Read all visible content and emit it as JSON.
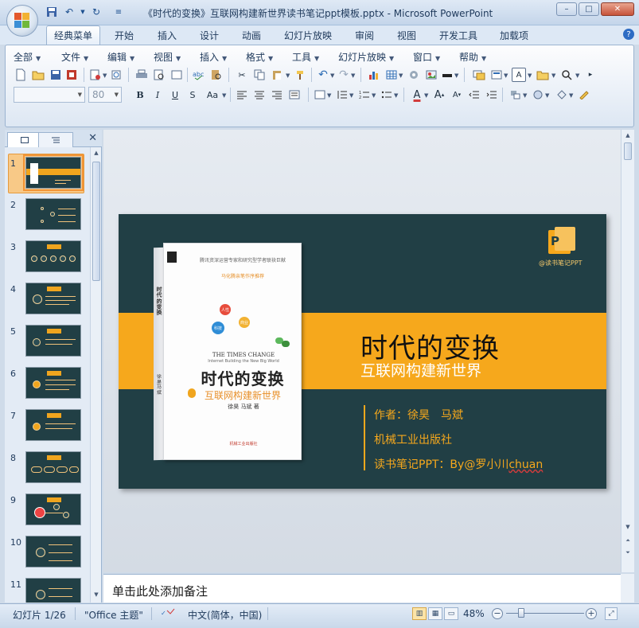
{
  "window": {
    "title": "《时代的变换》互联网构建新世界读书笔记ppt模板.pptx - Microsoft PowerPoint",
    "controls": {
      "minimize": "–",
      "maximize": "□",
      "close": "✕"
    }
  },
  "tabs": [
    {
      "label": "经典菜单",
      "active": true
    },
    {
      "label": "开始"
    },
    {
      "label": "插入"
    },
    {
      "label": "设计"
    },
    {
      "label": "动画"
    },
    {
      "label": "幻灯片放映"
    },
    {
      "label": "审阅"
    },
    {
      "label": "视图"
    },
    {
      "label": "开发工具"
    },
    {
      "label": "加载项"
    }
  ],
  "menus": [
    "全部",
    "文件",
    "编辑",
    "视图",
    "插入",
    "格式",
    "工具",
    "幻灯片放映",
    "窗口",
    "帮助"
  ],
  "font_size_value": "80",
  "format_buttons": {
    "bold": "B",
    "italic": "I",
    "underline": "U",
    "strike": "S",
    "case": "Aa",
    "grow": "A",
    "shrink": "A"
  },
  "pane_close": "✕",
  "thumbnails": [
    "1",
    "2",
    "3",
    "4",
    "5",
    "6",
    "7",
    "8",
    "9",
    "10",
    "11"
  ],
  "slide": {
    "title": "时代的变换",
    "subtitle": "互联网构建新世界",
    "author": "作者：徐昊　马斌",
    "publisher": "机械工业出版社",
    "notes_credit_prefix": "读书笔记PPT：By@罗小川",
    "notes_credit_suffix": "chuan",
    "logo_letter": "P",
    "logo_text": "@读书笔记PPT",
    "book": {
      "top_text": "腾讯资深运营专家和研究型学者联袂巨献",
      "top_text2": "马化腾亲笔作序推荐",
      "bubbles": [
        "人性",
        "科技",
        "商业"
      ],
      "en_title": "THE TIMES CHANGE",
      "en_sub": "Internet Building the New Big World",
      "cn_title": "时代的变换",
      "cn_sub": "互联网构建新世界",
      "authors": "徐昊 马斌 著",
      "publisher": "机械工业出版社",
      "side_title": "时代的变换",
      "side_authors": "徐昊 马斌"
    }
  },
  "notes_placeholder": "单击此处添加备注",
  "status": {
    "slide_counter": "幻灯片 1/26",
    "theme": "\"Office 主题\"",
    "language": "中文(简体，中国)",
    "zoom": "48%",
    "zoom_minus": "−",
    "zoom_plus": "+"
  },
  "colors": {
    "slide_bg": "#213f45",
    "slide_accent": "#f6a81c",
    "ribbon_bg": "#dde8f5"
  }
}
